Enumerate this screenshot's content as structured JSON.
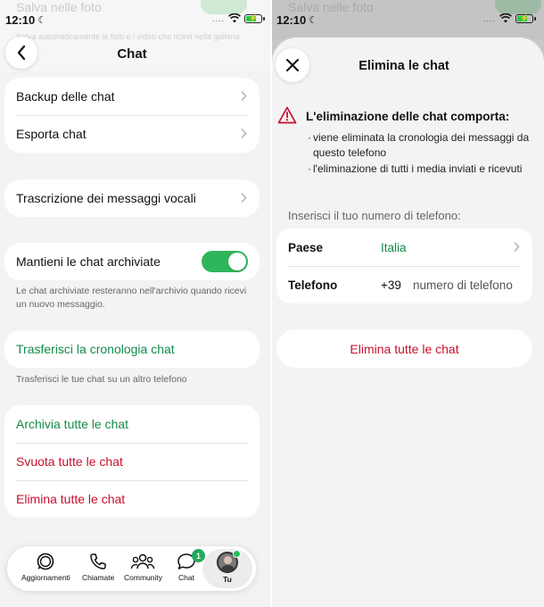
{
  "left": {
    "ghost": {
      "title": "Salva nelle foto",
      "subtitle": "Salva automaticamente le foto e i video che ricevi nella galleria"
    },
    "status": {
      "time": "12:10",
      "dots": "...."
    },
    "nav": {
      "title": "Chat"
    },
    "group1": [
      {
        "label": "Backup delle chat"
      },
      {
        "label": "Esporta chat"
      }
    ],
    "transcription": {
      "label": "Trascrizione dei messaggi vocali"
    },
    "archive": {
      "label": "Mantieni le chat archiviate",
      "enabled": true,
      "note": "Le chat archiviate resteranno nell'archivio quando ricevi un nuovo messaggio."
    },
    "transfer": {
      "label": "Trasferisci la cronologia chat",
      "note": "Trasferisci le tue chat su un altro telefono"
    },
    "actions": [
      {
        "label": "Archivia tutte le chat",
        "color": "#138a4a"
      },
      {
        "label": "Svuota tutte le chat",
        "color": "#c8102e"
      },
      {
        "label": "Elimina tutte le chat",
        "color": "#c8102e"
      }
    ],
    "tabbar": [
      {
        "label": "Aggiornamenti",
        "icon": "updates-icon"
      },
      {
        "label": "Chiamate",
        "icon": "phone-icon"
      },
      {
        "label": "Community",
        "icon": "community-icon"
      },
      {
        "label": "Chat",
        "icon": "chat-icon",
        "badge": "1"
      },
      {
        "label": "Tu",
        "icon": "avatar",
        "selected": true
      }
    ]
  },
  "right": {
    "ghost": {
      "title": "Salva nelle foto"
    },
    "status": {
      "time": "12:10",
      "dots": "...."
    },
    "sheet": {
      "title": "Elimina le chat",
      "warning_title": "L'eliminazione delle chat comporta:",
      "bullets": [
        "viene eliminata la cronologia dei messaggi da questo telefono",
        "l'eliminazione di tutti i media inviati e ricevuti"
      ],
      "phone_label": "Inserisci il tuo numero di telefono:",
      "country_key": "Paese",
      "country_value": "Italia",
      "phone_key": "Telefono",
      "country_code": "+39",
      "phone_placeholder": "numero di telefono",
      "delete_button": "Elimina tutte le chat"
    }
  },
  "colors": {
    "accent_green": "#138a4a",
    "danger_red": "#c8102e",
    "toggle_green": "#2fb55a"
  }
}
